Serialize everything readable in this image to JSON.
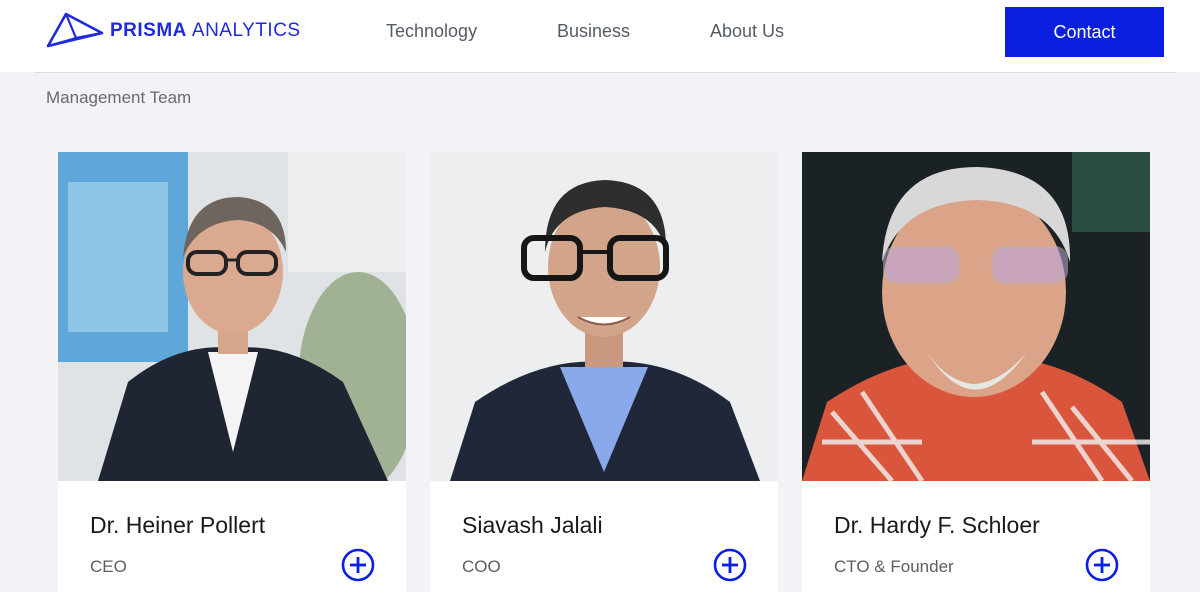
{
  "brand": {
    "name_bold": "PRISMA",
    "name_light": "ANALYTICS",
    "accent_color": "#1f2ad8",
    "logo_icon": "prism-logo-icon"
  },
  "nav": {
    "items": [
      {
        "label": "Technology"
      },
      {
        "label": "Business"
      },
      {
        "label": "About Us"
      }
    ],
    "contact_label": "Contact",
    "contact_color": "#0a1fe0"
  },
  "section": {
    "title": "Management Team"
  },
  "team": [
    {
      "name": "Dr. Heiner Pollert",
      "role": "CEO",
      "expand_icon": "plus-circle-icon"
    },
    {
      "name": "Siavash Jalali",
      "role": "COO",
      "expand_icon": "plus-circle-icon"
    },
    {
      "name": "Dr. Hardy F. Schloer",
      "role": "CTO & Founder",
      "expand_icon": "plus-circle-icon"
    }
  ]
}
